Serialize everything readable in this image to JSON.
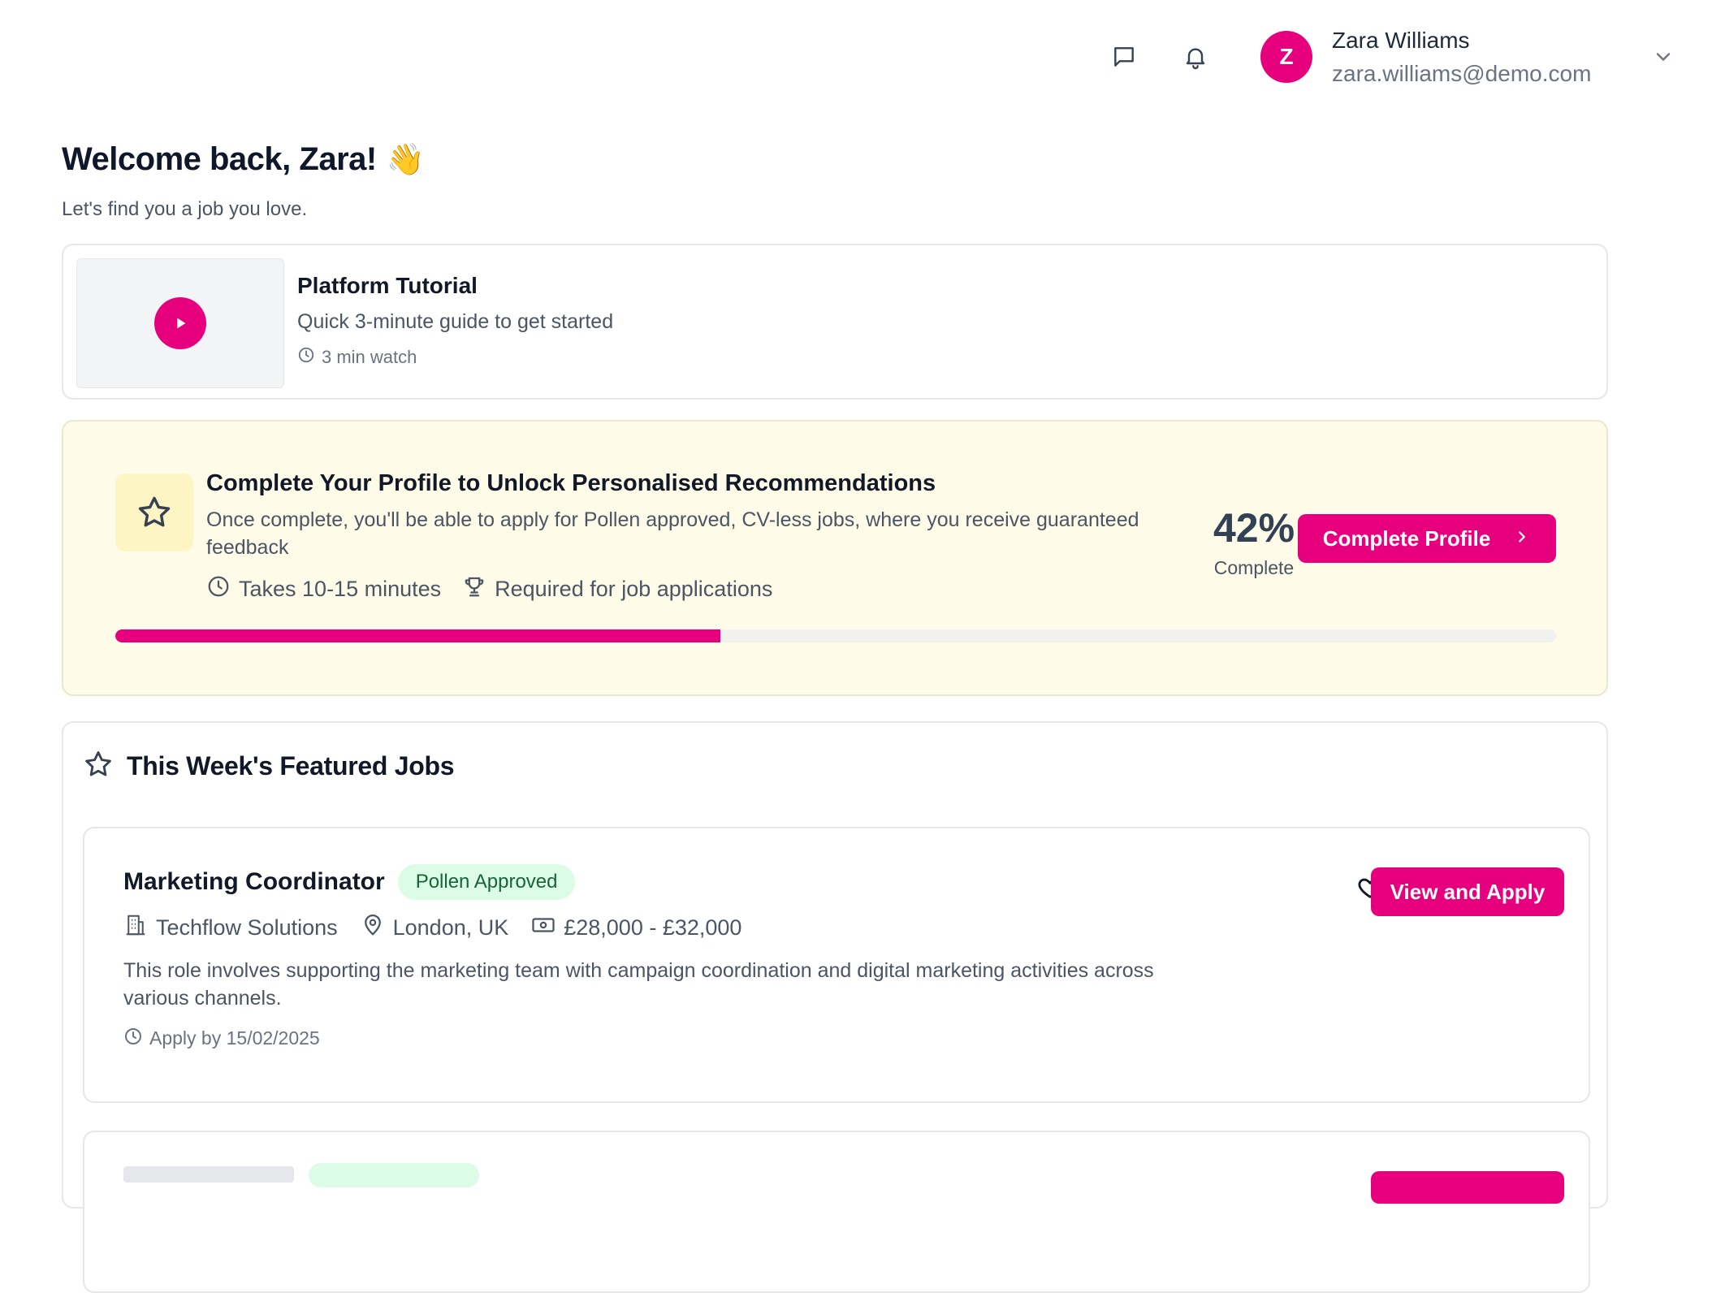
{
  "header": {
    "messages_icon": "message-square-icon",
    "notifications_icon": "bell-icon",
    "avatar_initial": "Z",
    "user_name": "Zara Williams",
    "user_email": "zara.williams@demo.com",
    "dropdown_icon": "chevron-down-icon"
  },
  "welcome": {
    "title": "Welcome back, Zara!",
    "emoji": "👋",
    "subtitle": "Let's find you a job you love."
  },
  "tutorial": {
    "title": "Platform Tutorial",
    "description": "Quick 3-minute guide to get started",
    "duration": "3 min watch"
  },
  "profile_banner": {
    "title": "Complete Your Profile to Unlock Personalised Recommendations",
    "description": "Once complete, you'll be able to apply for Pollen approved, CV-less jobs, where you receive guaranteed feedback",
    "time_note": "Takes 10-15 minutes",
    "required_note": "Required for job applications",
    "percent_label": "42%",
    "percent_value": 0.42,
    "complete_label": "Complete",
    "button_label": "Complete Profile"
  },
  "featured": {
    "section_title": "This Week's Featured Jobs",
    "jobs": [
      {
        "title": "Marketing Coordinator",
        "badge": "Pollen Approved",
        "company": "Techflow Solutions",
        "location": "London, UK",
        "salary": "£28,000 - £32,000",
        "description": "This role involves supporting the marketing team with campaign coordination and digital marketing activities across various channels.",
        "deadline": "Apply by 15/02/2025",
        "apply_label": "View and Apply"
      }
    ]
  },
  "colors": {
    "brand": "#e6007e",
    "banner_bg": "#fefbe8",
    "badge_bg": "#dcfce7",
    "badge_text": "#166534"
  }
}
